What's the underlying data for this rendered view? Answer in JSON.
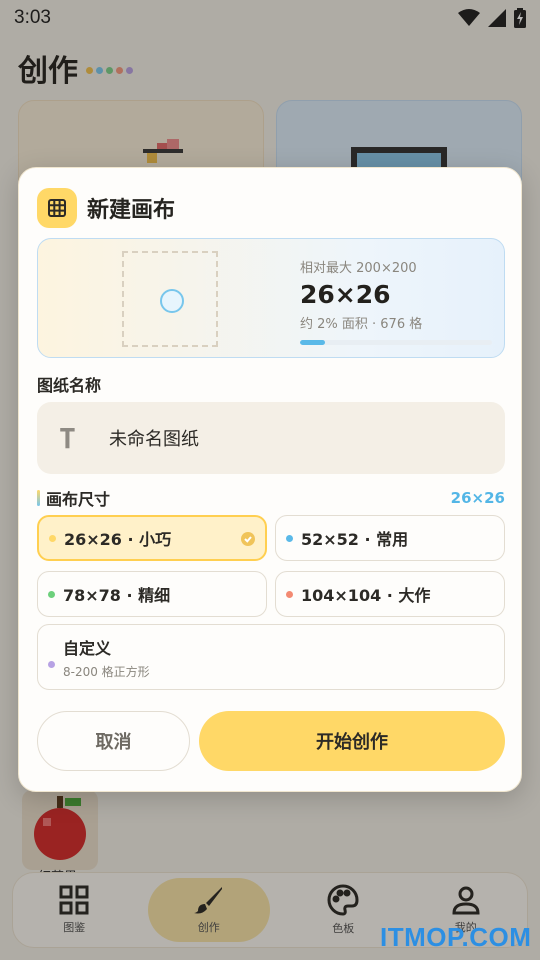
{
  "status_bar": {
    "time": "3:03",
    "wifi_icon": "wifi-icon",
    "signal_icon": "signal-icon",
    "battery_icon": "battery-charging-icon"
  },
  "page": {
    "title": "创作",
    "dot_colors": [
      "#f2c24f",
      "#7bc9ee",
      "#7fd18c",
      "#f59a80",
      "#b9a3e3"
    ]
  },
  "apple_card": {
    "label": "红苹果"
  },
  "tabbar": {
    "tabs": [
      {
        "label": "图鉴",
        "icon": "grid-icon",
        "active": false
      },
      {
        "label": "创作",
        "icon": "brush-icon",
        "active": true
      },
      {
        "label": "色板",
        "icon": "palette-icon",
        "active": false
      },
      {
        "label": "我的",
        "icon": "user-icon",
        "active": false
      }
    ]
  },
  "dialog": {
    "title": "新建画布",
    "icon": "grid-icon",
    "preview": {
      "caption": "相对最大 200×200",
      "size": "26×26",
      "subtitle": "约 2% 面积 · 676 格",
      "progress_fraction": 0.13
    },
    "name_label": "图纸名称",
    "name_value": "未命名图纸",
    "size_label": "画布尺寸",
    "size_current": "26×26",
    "options": [
      {
        "label": "26×26 · 小巧",
        "color": "#ffd867",
        "selected": true
      },
      {
        "label": "52×52 · 常用",
        "color": "#5ab9e8",
        "selected": false
      },
      {
        "label": "78×78 · 精细",
        "color": "#6dd07c",
        "selected": false
      },
      {
        "label": "104×104 · 大作",
        "color": "#f38a72",
        "selected": false
      }
    ],
    "custom": {
      "label": "自定义",
      "hint": "8-200 格正方形",
      "color": "#b7a2e4"
    },
    "cancel_label": "取消",
    "start_label": "开始创作"
  },
  "watermark": "ITMOP.COM"
}
